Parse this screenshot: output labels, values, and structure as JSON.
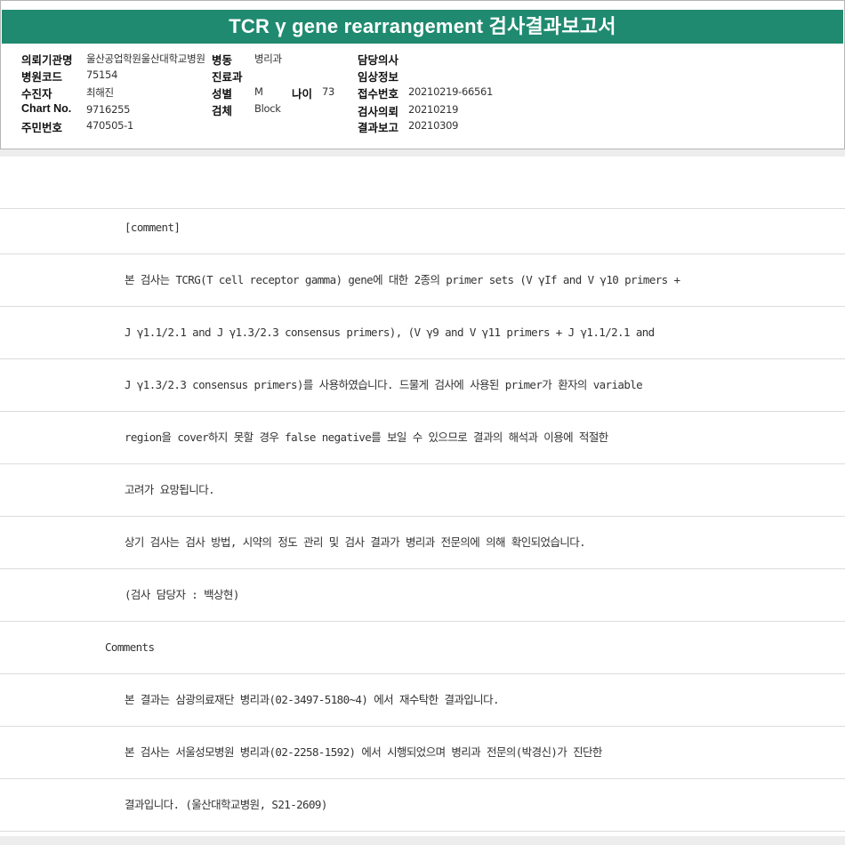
{
  "title": "TCR γ gene rearrangement 검사결과보고서",
  "header": {
    "col1": [
      {
        "label": "의뢰기관명",
        "value": "울산공업학원울산대학교병원"
      },
      {
        "label": "병원코드",
        "value": "75154"
      },
      {
        "label": "수진자",
        "value": "최해진"
      },
      {
        "label": "Chart No.",
        "value": "9716255"
      },
      {
        "label": "주민번호",
        "value": "470505-1"
      }
    ],
    "col2": [
      {
        "label": "병동",
        "value": "병리과"
      },
      {
        "label": "진료과",
        "value": ""
      },
      {
        "label": "성별",
        "value": "M"
      },
      {
        "label": "검체",
        "value": "Block"
      }
    ],
    "age": {
      "label": "나이",
      "value": "73"
    },
    "col3": [
      {
        "label": "담당의사",
        "value": ""
      },
      {
        "label": "임상정보",
        "value": ""
      },
      {
        "label": "접수번호",
        "value": "20210219-66561"
      },
      {
        "label": "검사의뢰",
        "value": "20210219"
      },
      {
        "label": "결과보고",
        "value": "20210309"
      }
    ]
  },
  "rows": [
    "",
    "[comment]",
    "본 검사는 TCRG(T cell receptor gamma) gene에 대한 2종의 primer sets (V  γIf and V  γ10 primers +",
    "J  γ1.1/2.1 and J  γ1.3/2.3 consensus primers), (V  γ9 and V  γ11 primers + J  γ1.1/2.1 and",
    "J  γ1.3/2.3 consensus primers)를 사용하였습니다. 드물게 검사에 사용된 primer가 환자의 variable",
    "region을 cover하지 못할 경우 false negative를 보일 수 있으므로 결과의 해석과 이용에 적절한",
    "고려가 요망됩니다.",
    "상기 검사는 검사 방법, 시약의 정도 관리 및 검사 결과가 병리과 전문의에 의해 확인되었습니다.",
    "(검사 담당자 : 백상현)",
    "Comments",
    "본 결과는 삼광의료재단 병리과(02-3497-5180~4) 에서 재수탁한 결과입니다.",
    "본 검사는 서울성모병원 병리과(02-2258-1592) 에서 시행되었으며 병리과 전문의(박경신)가 진단한",
    "결과입니다. (울산대학교병원, S21-2609)"
  ]
}
